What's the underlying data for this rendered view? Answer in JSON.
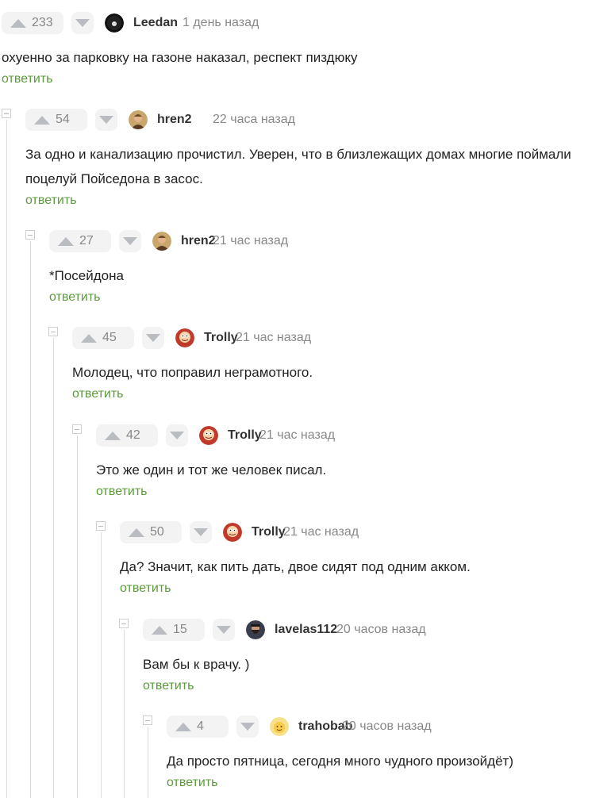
{
  "reply_label": "ответить",
  "colors": {
    "accent": "#5a9b3a",
    "muted": "#888888",
    "pill": "#f3f3f3"
  },
  "comments": [
    {
      "rating": "233",
      "author": "Leedan",
      "time": "1 день назад",
      "text": "охуенно за парковку на газоне наказал, респект пиздюку",
      "avatar": "dark-avatar"
    },
    {
      "rating": "54",
      "author": "hren2",
      "time": "22 часа назад",
      "text": "За одно и канализацию прочистил. Уверен, что в близлежащих домах многие поймали поцелуй Пойседона в засос.",
      "avatar": "portrait-avatar"
    },
    {
      "rating": "27",
      "author": "hren2",
      "time": "21 час назад",
      "text": "*Посейдона",
      "avatar": "portrait-avatar"
    },
    {
      "rating": "45",
      "author": "Trolly",
      "time": "21 час назад",
      "text": "Молодец, что поправил неграмотного.",
      "avatar": "cartoon-avatar"
    },
    {
      "rating": "42",
      "author": "Trolly",
      "time": "21 час назад",
      "text": "Это же один и тот же человек писал.",
      "avatar": "cartoon-avatar"
    },
    {
      "rating": "50",
      "author": "Trolly",
      "time": "21 час назад",
      "text": "Да? Значит, как пить дать, двое сидят под одним акком.",
      "avatar": "cartoon-avatar"
    },
    {
      "rating": "15",
      "author": "lavelas112",
      "time": "20 часов назад",
      "text": "Вам бы к врачу. )",
      "avatar": "bearded-avatar"
    },
    {
      "rating": "4",
      "author": "trahobab",
      "time": "20 часов назад",
      "text": "Да просто пятница, сегодня много чудного произойдёт)",
      "avatar": "yellow-avatar"
    }
  ]
}
